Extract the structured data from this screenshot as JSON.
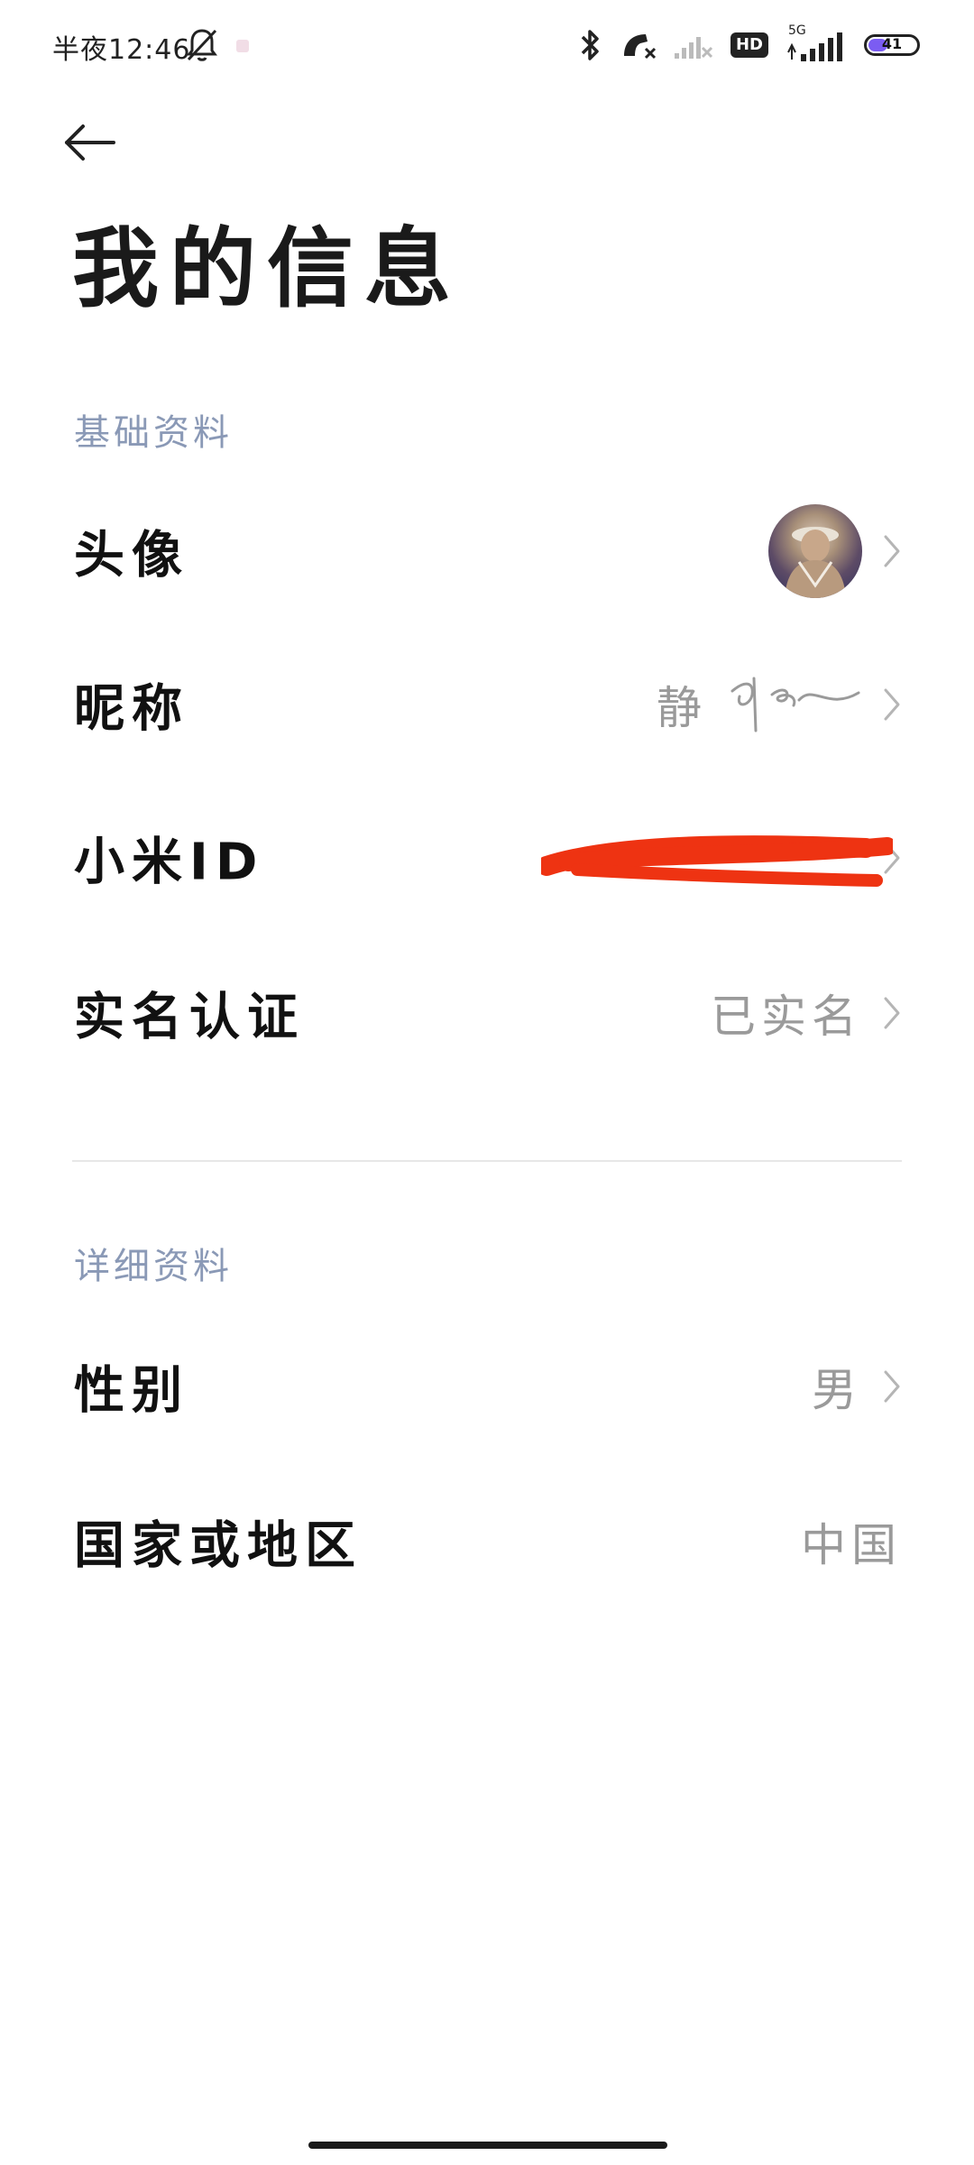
{
  "status_bar": {
    "time": "半夜12:46",
    "network_label": "5G",
    "hd_label": "HD",
    "battery": "41"
  },
  "header": {
    "title": "我的信息"
  },
  "basic": {
    "section_title": "基础资料",
    "rows": [
      {
        "label": "头像",
        "value": ""
      },
      {
        "label": "昵称",
        "value": "静"
      },
      {
        "label": "小米ID",
        "value": ""
      },
      {
        "label": "实名认证",
        "value": "已实名"
      }
    ]
  },
  "detail": {
    "section_title": "详细资料",
    "rows": [
      {
        "label": "性别",
        "value": "男"
      },
      {
        "label": "国家或地区",
        "value": "中国"
      }
    ]
  },
  "colors": {
    "section_header": "#8a99b6",
    "value_gray": "#9a9a9a",
    "redaction": "#ee3312",
    "battery_accent": "#7b5cf2"
  },
  "icons": [
    "back-arrow-icon",
    "chevron-right-icon",
    "bell-off-icon",
    "bluetooth-icon",
    "call-off-icon",
    "signal-icon"
  ]
}
